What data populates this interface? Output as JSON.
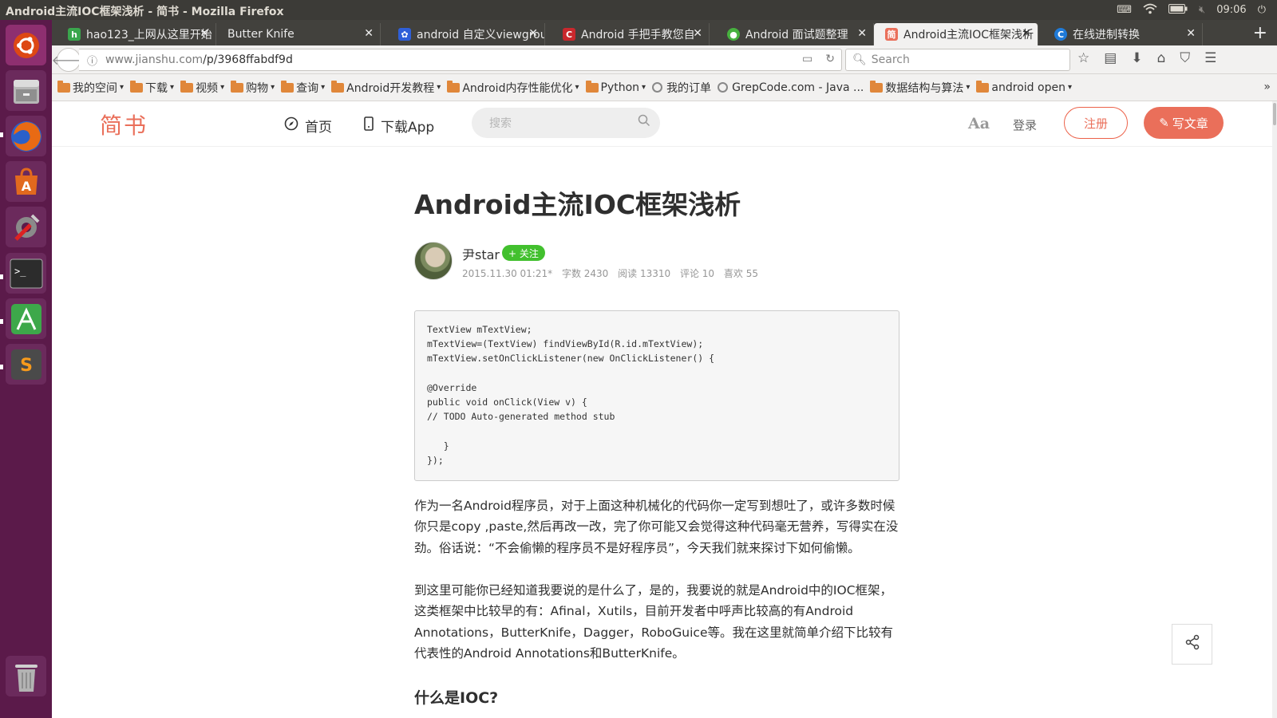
{
  "window": {
    "title": "Android主流IOC框架浅析 - 简书 - Mozilla Firefox",
    "clock": "09:06",
    "tray_icons": [
      "keyboard-icon",
      "wifi-icon",
      "battery-icon",
      "volume-muted-icon",
      "power-icon"
    ]
  },
  "launcher": {
    "items": [
      {
        "name": "ubuntu-dash-icon",
        "color": "#d9501e"
      },
      {
        "name": "files-icon",
        "color": "#8a8a8a"
      },
      {
        "name": "firefox-icon",
        "color": "#e66000"
      },
      {
        "name": "software-center-icon",
        "color": "#e2691e"
      },
      {
        "name": "system-settings-icon",
        "color": "#888888"
      },
      {
        "name": "terminal-icon",
        "color": "#2d2d2d"
      },
      {
        "name": "android-studio-icon",
        "color": "#3da84a"
      },
      {
        "name": "sublime-text-icon",
        "color": "#4a4a4a"
      },
      {
        "name": "trash-icon",
        "color": "#9a9a9a"
      }
    ]
  },
  "tabs": [
    {
      "label": "hao123_上网从这里开始",
      "icon": "hao123-icon",
      "icon_color": "#3aa64d",
      "active": false
    },
    {
      "label": "Butter Knife",
      "icon": "",
      "icon_color": "",
      "active": false
    },
    {
      "label": "android 自定义viewgroup",
      "icon": "baidu-icon",
      "icon_color": "#2f5fd8",
      "active": false
    },
    {
      "label": "Android 手把手教您自",
      "icon": "csdn-icon",
      "icon_color": "#c9282d",
      "active": false
    },
    {
      "label": "Android 面试题整理",
      "icon": "wechat-icon",
      "icon_color": "#47b13f",
      "active": false
    },
    {
      "label": "Android主流IOC框架浅析",
      "icon": "jianshu-icon",
      "icon_color": "#ea6f5a",
      "active": true
    },
    {
      "label": "在线进制转换",
      "icon": "c-site-icon",
      "icon_color": "#1f7ad8",
      "active": false
    }
  ],
  "navbar": {
    "url_host": "www.jianshu.com",
    "url_path": "/p/3968ffabdf9d",
    "search_placeholder": "Search"
  },
  "bookmarks": [
    {
      "label": "我的空间",
      "type": "folder"
    },
    {
      "label": "下载",
      "type": "folder"
    },
    {
      "label": "视频",
      "type": "folder"
    },
    {
      "label": "购物",
      "type": "folder"
    },
    {
      "label": "查询",
      "type": "folder"
    },
    {
      "label": "Android开发教程",
      "type": "folder"
    },
    {
      "label": "Android内存性能优化",
      "type": "folder"
    },
    {
      "label": "Python",
      "type": "folder"
    },
    {
      "label": "我的订单",
      "type": "link"
    },
    {
      "label": "GrepCode.com - Java ...",
      "type": "link"
    },
    {
      "label": "数据结构与算法",
      "type": "folder"
    },
    {
      "label": "android open",
      "type": "folder"
    }
  ],
  "site": {
    "logo": "简书",
    "nav_home": "首页",
    "nav_app": "下载App",
    "search_placeholder": "搜索",
    "font_toggle": "Aa",
    "login": "登录",
    "signup": "注册",
    "write": "写文章"
  },
  "article": {
    "title": "Android主流IOC框架浅析",
    "author": "尹star",
    "follow": "+ 关注",
    "date": "2015.11.30 01:21*",
    "word_count": "字数 2430",
    "reads": "阅读 13310",
    "comments": "评论 10",
    "likes": "喜欢 55",
    "code": "TextView mTextView;\nmTextView=(TextView) findViewById(R.id.mTextView);\nmTextView.setOnClickListener(new OnClickListener() {\n\n@Override\npublic void onClick(View v) {\n// TODO Auto-generated method stub\n\n   }\n});",
    "paragraph1": "作为一名Android程序员，对于上面这种机械化的代码你一定写到想吐了，或许多数时候你只是copy ,paste,然后再改一改，完了你可能又会觉得这种代码毫无营养，写得实在没劲。俗话说：“不会偷懒的程序员不是好程序员”，今天我们就来探讨下如何偷懒。",
    "paragraph2": "到这里可能你已经知道我要说的是什么了，是的，我要说的就是Android中的IOC框架，这类框架中比较早的有：Afinal，Xutils，目前开发者中呼声比较高的有Android Annotations，ButterKnife，Dagger，RoboGuice等。我在这里就简单介绍下比较有代表性的Android Annotations和ButterKnife。",
    "heading": "什么是IOC?"
  }
}
